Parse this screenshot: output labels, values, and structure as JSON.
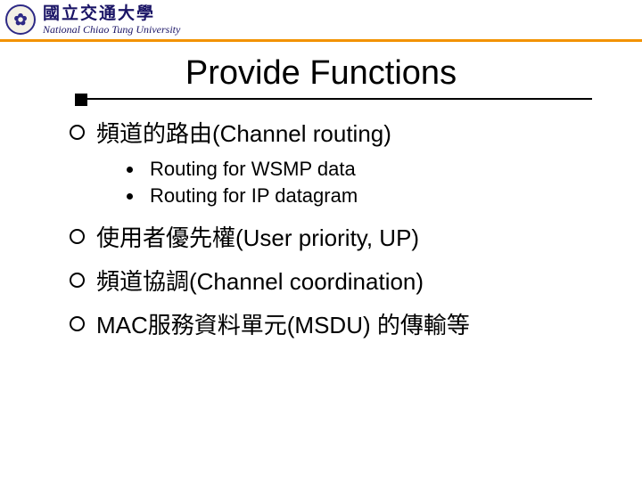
{
  "header": {
    "logo_glyph": "✿",
    "uni_zh": "國立交通大學",
    "uni_en": "National Chiao Tung University"
  },
  "title": "Provide Functions",
  "bullets": {
    "b1": "頻道的路由(Channel routing)",
    "b1_sub1": "Routing for WSMP data",
    "b1_sub2": "Routing for IP datagram",
    "b2": "使用者優先權(User priority, UP)",
    "b3": "頻道協調(Channel coordination)",
    "b4": "MAC服務資料單元(MSDU) 的傳輸等"
  }
}
